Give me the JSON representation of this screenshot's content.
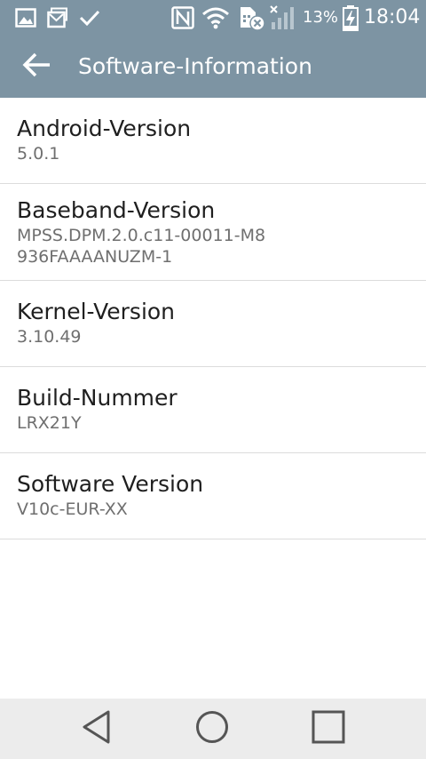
{
  "status_bar": {
    "icons": [
      "image-icon",
      "message-icon",
      "check-icon",
      "nfc-icon",
      "wifi-icon",
      "sim-card-off-icon",
      "signal-icon",
      "battery-charging-icon"
    ],
    "battery_percent": "13%",
    "time": "18:04"
  },
  "action_bar": {
    "back_icon": "back-arrow-icon",
    "title": "Software-Information"
  },
  "items": [
    {
      "title": "Android-Version",
      "value": "5.0.1"
    },
    {
      "title": "Baseband-Version",
      "value": "MPSS.DPM.2.0.c11-00011-M8936FAAAANUZM-1"
    },
    {
      "title": "Kernel-Version",
      "value": "3.10.49"
    },
    {
      "title": "Build-Nummer",
      "value": "LRX21Y"
    },
    {
      "title": "Software Version",
      "value": "V10c-EUR-XX"
    }
  ],
  "nav_bar": {
    "back_icon": "nav-back-icon",
    "home_icon": "nav-home-icon",
    "recent_icon": "nav-recent-apps-icon"
  },
  "colors": {
    "top_bar": "#7d94a3",
    "nav_bar": "#ececec",
    "title_text": "#1f1f1f",
    "value_text": "#6f6f6f",
    "divider": "#dcdcdc"
  }
}
